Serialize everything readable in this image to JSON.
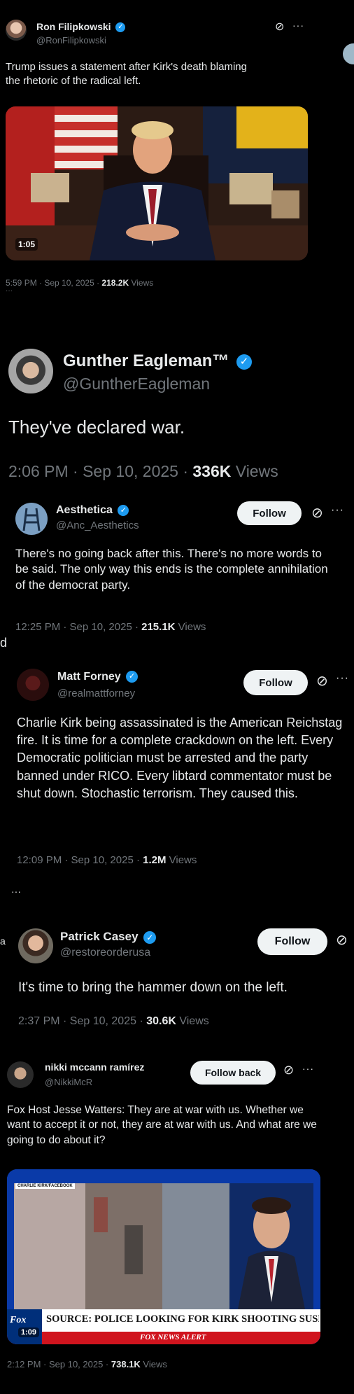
{
  "tweets": [
    {
      "name": "Ron Filipkowski",
      "handle": "@RonFilipkowski",
      "text": "Trump issues a statement after Kirk's death blaming the rhetoric of the radical left.",
      "time": "5:59 PM · Sep 10, 2025 · ",
      "views": "218.2K",
      "views_label": " Views",
      "video_duration": "1:05",
      "overflow_marker": "···"
    },
    {
      "name": "Gunther Eagleman™",
      "handle": "@GuntherEagleman",
      "text": "They've declared war.",
      "time": "2:06 PM · Sep 10, 2025 · ",
      "views": "336K",
      "views_label": " Views"
    },
    {
      "name": "Aesthetica",
      "handle": "@Anc_Aesthetics",
      "follow_label": "Follow",
      "text": "There's no going back after this. There's no more words to be said. The only way this ends is the complete annihilation of the democrat party.",
      "time": "12:25 PM · Sep 10, 2025 · ",
      "views": "215.1K",
      "views_label": " Views",
      "edge_mark": "d"
    },
    {
      "name": "Matt Forney",
      "handle": "@realmattforney",
      "follow_label": "Follow",
      "text": "Charlie Kirk being assassinated is the American Reichstag fire. It is time for a complete crackdown on the left. Every Democratic politician must be arrested and the party banned under RICO. Every libtard commentator must be shut down. Stochastic terrorism. They caused this.",
      "time": "12:09 PM · Sep 10, 2025 · ",
      "views": "1.2M",
      "views_label": " Views",
      "overflow_marker": "···"
    },
    {
      "name": "Patrick Casey",
      "handle": "@restoreorderusa",
      "follow_label": "Follow",
      "text": "It's time to bring the hammer down on the left.",
      "time": "2:37 PM · Sep 10, 2025 · ",
      "views": "30.6K",
      "views_label": " Views",
      "edge_mark": "a"
    },
    {
      "name": "nikki mccann ramírez",
      "handle": "@NikkiMcR",
      "follow_label": "Follow back",
      "text": "Fox Host Jesse Watters: They are at war with us. Whether we want to accept it or not, they are at war with us. And what are we going to do about it?",
      "time": "2:12 PM · Sep 10, 2025 · ",
      "views": "738.1K",
      "views_label": " Views",
      "video_duration": "1:09",
      "chyron": "SOURCE: POLICE LOOKING FOR KIRK SHOOTING SUSPECT",
      "alert": "FOX NEWS ALERT",
      "corner_tag": "CHARLIE KIRK/FACEBOOK",
      "news_logo": "Fox"
    }
  ],
  "icons": {
    "verified": "✓",
    "grok": "⊘",
    "more": "···"
  },
  "colors": {
    "background": "#000000",
    "verified": "#1d9bf0",
    "muted": "#71767b",
    "text": "#e7e9ea"
  }
}
